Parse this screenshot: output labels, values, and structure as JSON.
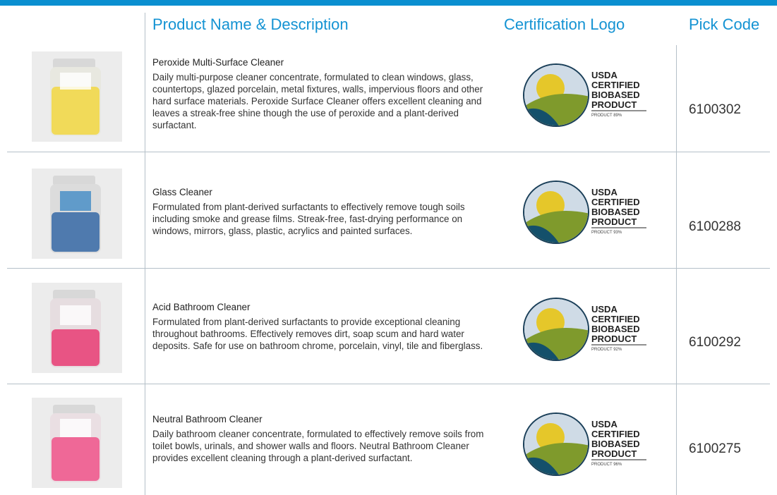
{
  "header": {
    "product_col": "Product Name & Description",
    "cert_col": "Certification Logo",
    "pick_col": "Pick Code"
  },
  "logo_text": {
    "line1": "USDA",
    "line2": "CERTIFIED",
    "line3": "BIOBASED",
    "line4": "PRODUCT"
  },
  "products": [
    {
      "name": "Peroxide Multi-Surface Cleaner",
      "description": "Daily multi-purpose cleaner concentrate, formulated to clean windows, glass, countertops, glazed porcelain, metal fixtures, walls, impervious floors and other hard surface materials. Peroxide Surface Cleaner offers excellent cleaning and leaves a streak-free shine though the use of peroxide and a plant-derived surfactant.",
      "logo_percent": "PRODUCT 89%",
      "pick_code": "6100302",
      "liquid_color": "#f2d84a"
    },
    {
      "name": "Glass Cleaner",
      "description": "Formulated from plant-derived surfactants to effectively remove tough soils including smoke and grease films. Streak-free, fast-drying performance on windows, mirrors, glass, plastic, acrylics and painted surfaces.",
      "logo_percent": "PRODUCT 93%",
      "pick_code": "6100288",
      "liquid_color": "#3f6fa8"
    },
    {
      "name": "Acid Bathroom Cleaner",
      "description": "Formulated from plant-derived surfactants to provide exceptional cleaning throughout bathrooms. Effectively removes dirt, soap scum and hard water deposits. Safe for use on bathroom chrome, porcelain, vinyl, tile and fiberglass.",
      "logo_percent": "PRODUCT 92%",
      "pick_code": "6100292",
      "liquid_color": "#e8457a"
    },
    {
      "name": "Neutral Bathroom Cleaner",
      "description": "Daily bathroom cleaner concentrate, formulated to effectively remove soils from toilet bowls, urinals, and shower walls and floors. Neutral Bathroom Cleaner provides excellent cleaning through a plant-derived surfactant.",
      "logo_percent": "PRODUCT 96%",
      "pick_code": "6100275",
      "liquid_color": "#ef5b8e"
    }
  ]
}
